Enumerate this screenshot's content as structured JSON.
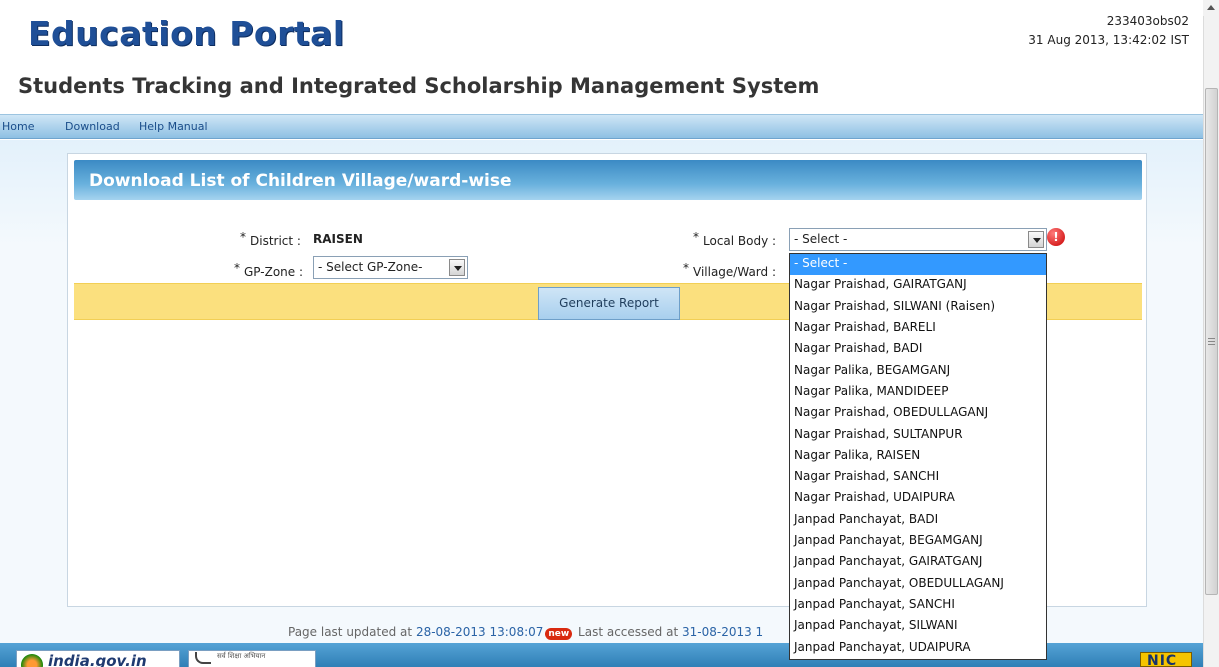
{
  "header": {
    "portal_name": "Education Portal",
    "user_id": "233403obs02",
    "datetime": "31 Aug 2013, 13:42:02 IST",
    "system_title": "Students Tracking and Integrated Scholarship Management System"
  },
  "nav": {
    "items": [
      {
        "label": "Home"
      },
      {
        "label": "Download"
      },
      {
        "label": "Help Manual"
      }
    ]
  },
  "panel": {
    "title": "Download List of Children Village/ward-wise"
  },
  "form": {
    "required_marker": "*",
    "district": {
      "label": "District :",
      "value": "RAISEN"
    },
    "gp_zone": {
      "label": "GP-Zone :",
      "selected": "- Select GP-Zone-"
    },
    "local_body": {
      "label": "Local Body :",
      "selected": "- Select -"
    },
    "village_ward": {
      "label": "Village/Ward :"
    },
    "error_icon": "!",
    "generate_button": "Generate Report"
  },
  "local_body_dropdown": {
    "options": [
      "- Select -",
      "Nagar Praishad, GAIRATGANJ",
      "Nagar Praishad, SILWANI (Raisen)",
      "Nagar Praishad, BARELI",
      "Nagar Praishad, BADI",
      "Nagar Palika, BEGAMGANJ",
      "Nagar Palika, MANDIDEEP",
      "Nagar Praishad, OBEDULLAGANJ",
      "Nagar Praishad, SULTANPUR",
      "Nagar Palika, RAISEN",
      "Nagar Praishad, SANCHI",
      "Nagar Praishad, UDAIPURA",
      "Janpad Panchayat, BADI",
      "Janpad Panchayat, BEGAMGANJ",
      "Janpad Panchayat, GAIRATGANJ",
      "Janpad Panchayat, OBEDULLAGANJ",
      "Janpad Panchayat, SANCHI",
      "Janpad Panchayat, SILWANI",
      "Janpad Panchayat, UDAIPURA"
    ],
    "highlighted_index": 0
  },
  "footer": {
    "updated_prefix": "Page last updated at",
    "updated_at": "28-08-2013 13:08:07",
    "new_badge": "new",
    "accessed_prefix": "Last accessed at",
    "accessed_at": "31-08-2013 1"
  },
  "bottom_logos": {
    "india_gov": "india.gov.in",
    "sarva": "सर्व शिक्षा अभियान",
    "nic": "NIC"
  },
  "colors": {
    "brand_blue": "#1f4f97",
    "nav_gradient_top": "#cfe6f6",
    "panel_header_blue": "#3b8ac4",
    "button_bar_yellow": "#fbe07e",
    "selected_option_blue": "#3399ff",
    "required_red": "#d91d1d"
  }
}
